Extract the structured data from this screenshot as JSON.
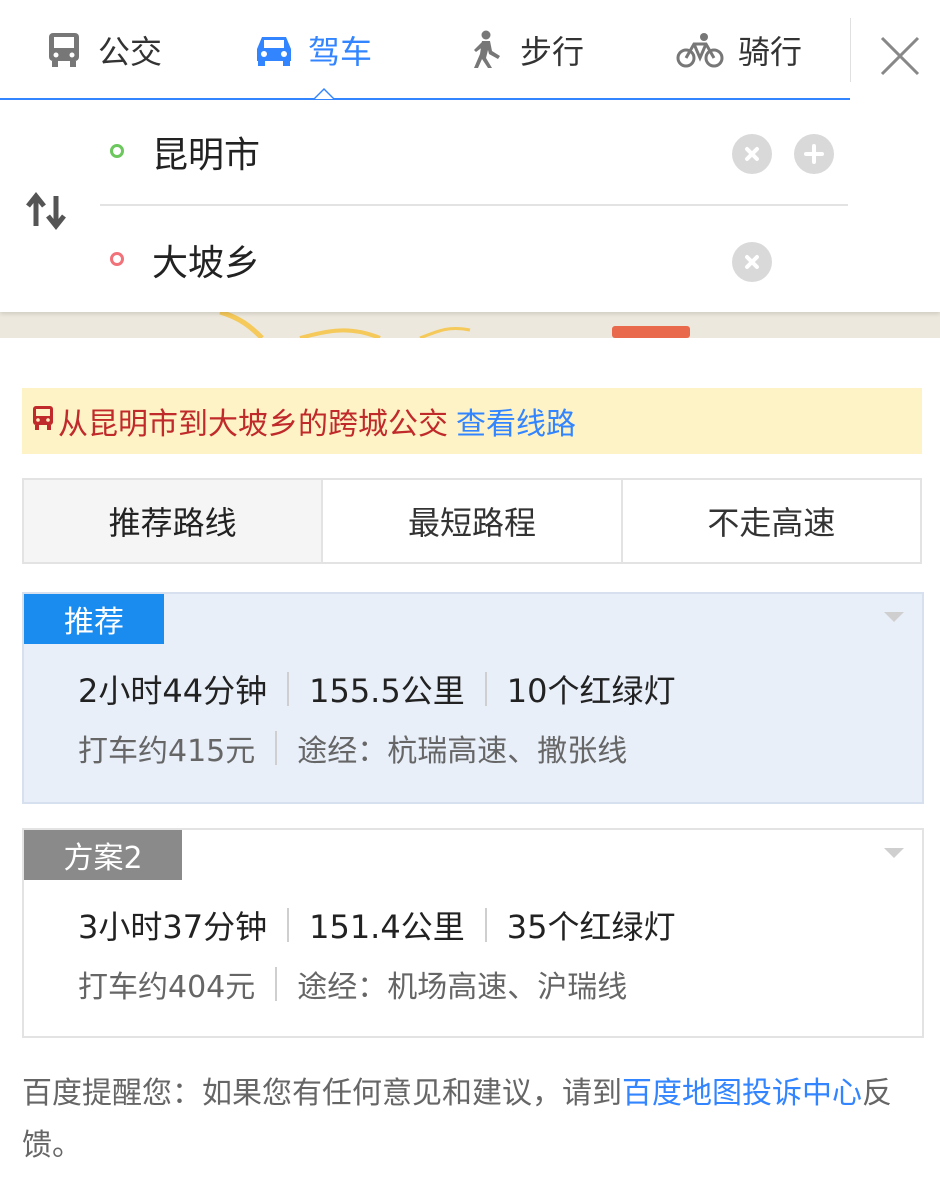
{
  "tabs": [
    {
      "label": "公交",
      "icon": "bus-icon"
    },
    {
      "label": "驾车",
      "icon": "car-icon"
    },
    {
      "label": "步行",
      "icon": "walk-icon"
    },
    {
      "label": "骑行",
      "icon": "bike-icon"
    }
  ],
  "active_tab": "驾车",
  "route": {
    "start": "昆明市",
    "end": "大坡乡"
  },
  "banner": {
    "text": "从昆明市到大坡乡的跨城公交",
    "link": "查看线路"
  },
  "strategy": [
    "推荐路线",
    "最短路程",
    "不走高速"
  ],
  "plans": [
    {
      "tag": "推荐",
      "duration": "2小时44分钟",
      "distance": "155.5公里",
      "lights": "10个红绿灯",
      "taxi": "打车约415元",
      "via": "途经：杭瑞高速、撒张线"
    },
    {
      "tag": "方案2",
      "duration": "3小时37分钟",
      "distance": "151.4公里",
      "lights": "35个红绿灯",
      "taxi": "打车约404元",
      "via": "途经：机场高速、沪瑞线"
    }
  ],
  "footer": {
    "prefix": "百度提醒您：如果您有任何意见和建议，请到",
    "link": "百度地图投诉中心",
    "suffix": "反馈。"
  },
  "colors": {
    "accent": "#3385ff",
    "recommend_tag": "#1a8cf0",
    "plan2_tag": "#8a8a8a",
    "banner_bg": "#fef3c6",
    "banner_text": "#c02a2a"
  }
}
